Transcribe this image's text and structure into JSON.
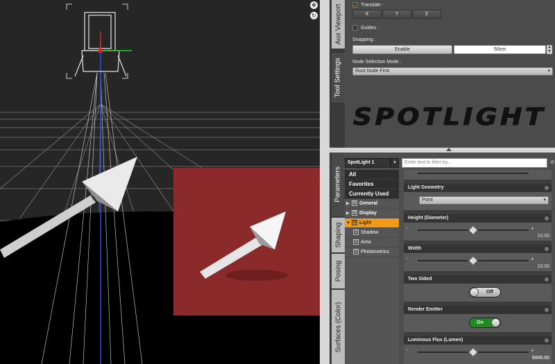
{
  "viewport": {
    "nav_icons": [
      "orbit-icon",
      "pan-icon"
    ]
  },
  "side_tabs_top": {
    "aux_viewport": "Aux Viewport",
    "tool_settings": "Tool Settings"
  },
  "tool_settings": {
    "translate_label": "Translate :",
    "translate_checked": true,
    "axes": [
      "X",
      "Y",
      "Z"
    ],
    "guides_label": "Guides :",
    "snapping_label": "Snapping :",
    "enable_label": "Enable",
    "snap_value": "50cm",
    "node_selection_label": "Node Selection Mode :",
    "node_selection_value": "Root Node First",
    "banner_text": "SPOTLIGHT"
  },
  "side_tabs_bottom": {
    "parameters": "Parameters",
    "shaping": "Shaping",
    "posing": "Posing",
    "surfaces": "Surfaces (Color)"
  },
  "parameters": {
    "node_name": "SpotLight 1",
    "filter_placeholder": "Enter text to filter by...",
    "groups": [
      "All",
      "Favorites",
      "Currently Used"
    ],
    "tree": [
      {
        "label": "General",
        "expanded": false,
        "level": 0
      },
      {
        "label": "Display",
        "expanded": false,
        "level": 0
      },
      {
        "label": "Light",
        "expanded": true,
        "level": 0,
        "selected": true
      },
      {
        "label": "Shadow",
        "level": 1
      },
      {
        "label": "Area",
        "level": 1
      },
      {
        "label": "Photometrics",
        "level": 1
      }
    ],
    "properties": {
      "light_geometry": {
        "label": "Light Geometry",
        "value": "Point"
      },
      "height": {
        "label": "Height (Diameter)",
        "value": "10.00",
        "level": 0.5
      },
      "width": {
        "label": "Width",
        "value": "10.00",
        "level": 0.5
      },
      "two_sided": {
        "label": "Two Sided",
        "state": "Off"
      },
      "render_emitter": {
        "label": "Render Emitter",
        "state": "On"
      },
      "luminous_flux": {
        "label": "Luminous Flux (Lumen)",
        "value": "5000.00",
        "level": 0.5
      }
    }
  },
  "colors": {
    "accent": "#f09a1a",
    "toggle_on": "#1f8a1f",
    "render_bg": "#8a2a2a"
  }
}
